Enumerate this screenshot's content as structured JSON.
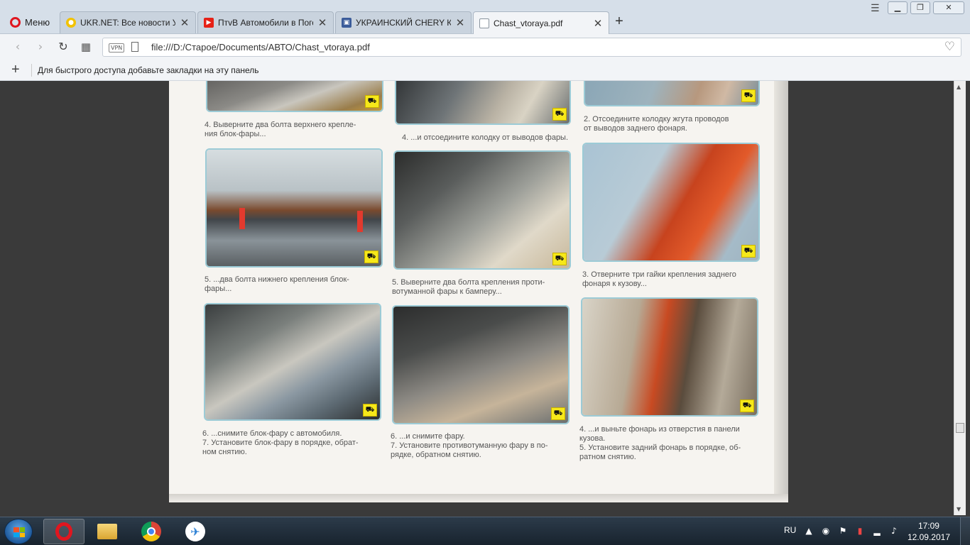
{
  "browser": {
    "menu_label": "Меню",
    "tabs": [
      {
        "title": "UKR.NET: Все новости Укр",
        "icon": "ukrnet-icon",
        "color": "#f2c200",
        "active": false
      },
      {
        "title": "ПтvВ Автомобили в Погоі",
        "icon": "youtube-icon",
        "color": "#e62117",
        "active": false
      },
      {
        "title": "УКРАИНСКИЙ CHERY КЛУ",
        "icon": "forum-icon",
        "color": "#3b5c9a",
        "active": false
      },
      {
        "title": "Chast_vtoraya.pdf",
        "icon": "document-icon",
        "color": "#9aa4ae",
        "active": true
      }
    ],
    "new_tab": "+",
    "address": {
      "vpn_label": "VPN",
      "url": "file:///D:/Старое/Documents/АВТО/Chast_vtoraya.pdf"
    },
    "bookmarks_hint": "Для быстрого доступа добавьте закладки на эту панель"
  },
  "pdf": {
    "captions": [
      [
        "4. Выверните два болта верхнего крепле-",
        "ния блок-фары..."
      ],
      [
        "4. ...и отсоедините колодку от выводов фары."
      ],
      [
        "2. Отсоедините колодку жгута проводов",
        "от выводов заднего фонаря."
      ],
      [
        "5. ...два болта нижнего крепления блок-",
        "фары..."
      ],
      [
        "5. Выверните два болта крепления проти-",
        "вотуманной фары к бамперу..."
      ],
      [
        "3. Отверните три гайки крепления заднего",
        "фонаря к кузову..."
      ],
      [
        "6. ...снимите блок-фару с автомобиля.",
        "7. Установите блок-фару в порядке, обрат-",
        "ном снятию."
      ],
      [
        "6. ...и снимите фару.",
        "7. Установите противотуманную фару в по-",
        "рядке, обратном снятию."
      ],
      [
        "4. ...и выньте фонарь из отверстия в панели",
        "кузова.",
        "5. Установите задний фонарь в порядке, об-",
        "ратном снятию."
      ]
    ]
  },
  "taskbar": {
    "language": "RU",
    "time": "17:09",
    "date": "12.09.2017",
    "apps": [
      "opera-icon",
      "file-explorer-icon",
      "chrome-icon",
      "messenger-icon"
    ]
  },
  "colors": {
    "accent_badge": "#f6e81a",
    "photo_border": "#9ccbd6",
    "opera_red": "#e0161f"
  }
}
